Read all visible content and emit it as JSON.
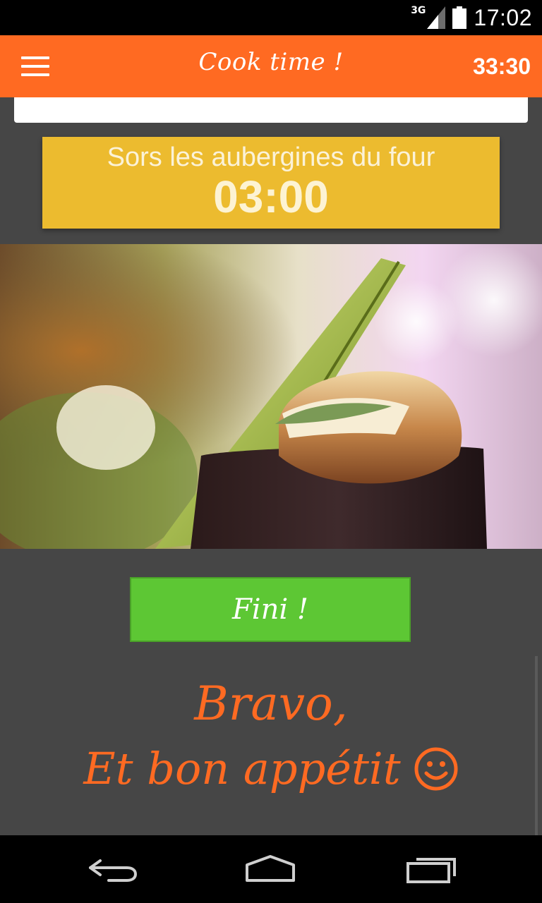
{
  "status_bar": {
    "network": "3G",
    "time": "17:02"
  },
  "app_bar": {
    "title": "Cook time !",
    "total_timer": "33:30",
    "menu_icon": "hamburger-menu-icon"
  },
  "step": {
    "instruction": "Sors les aubergines du four",
    "timer": "03:00",
    "color": "#ecbb2f"
  },
  "photo": {
    "icon": "stuffed-eggplant-photo"
  },
  "actions": {
    "finish_label": "Fini !"
  },
  "congrats": {
    "line1": "Bravo,",
    "line2": "Et bon appétit",
    "icon": "smiley-icon"
  },
  "nav_bar": {
    "back_icon": "back-icon",
    "home_icon": "home-icon",
    "recents_icon": "recents-icon"
  },
  "colors": {
    "accent": "#ff6a22",
    "success": "#5dc734",
    "background": "#464646"
  }
}
